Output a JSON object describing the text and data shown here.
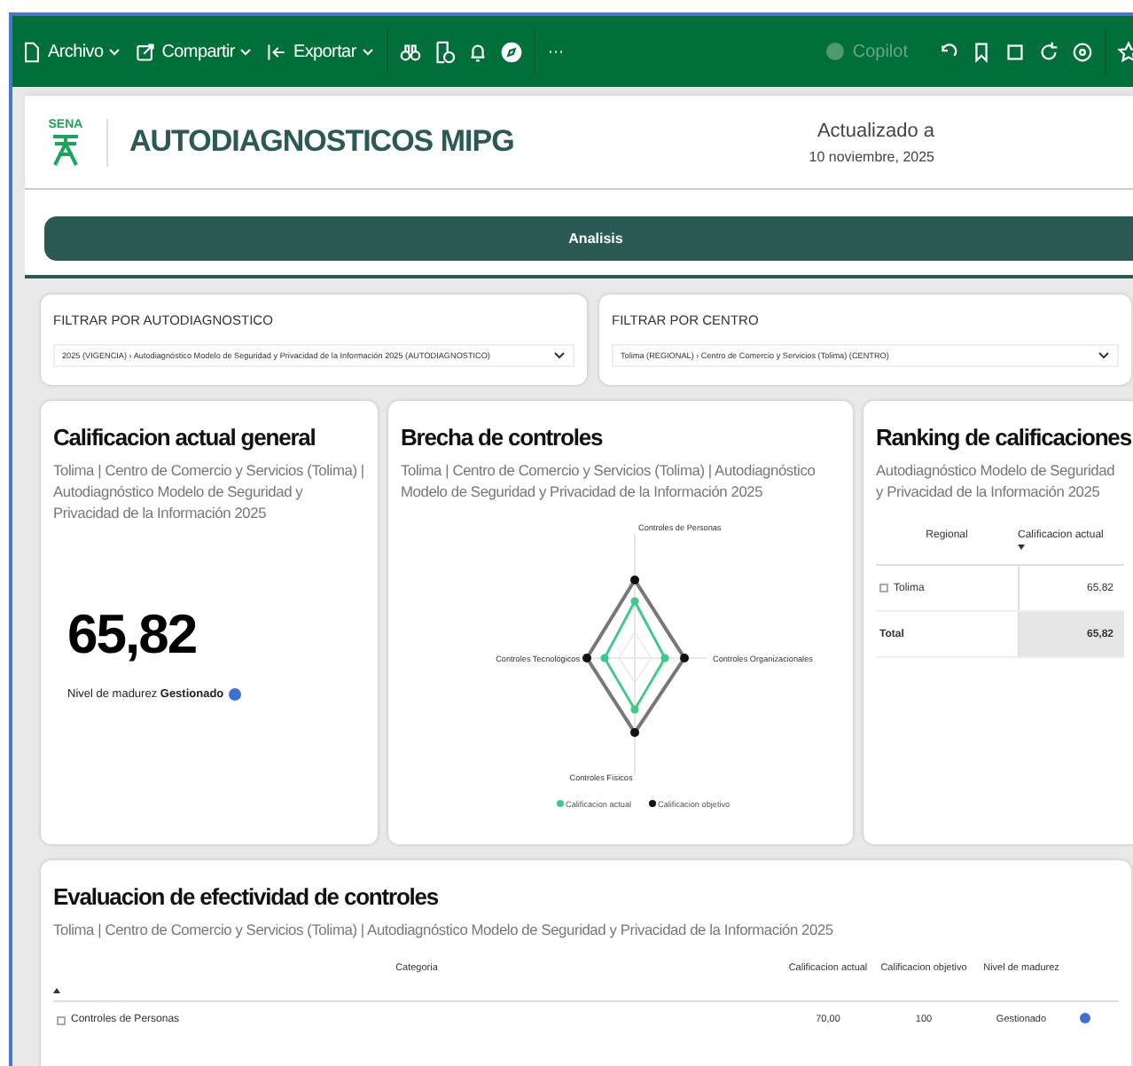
{
  "toolbar": {
    "menus": [
      {
        "label": "Archivo"
      },
      {
        "label": "Compartir"
      },
      {
        "label": "Exportar"
      }
    ],
    "more": "···",
    "copilot": {
      "label": "Copilot",
      "disabled": true
    }
  },
  "header": {
    "logo_text": "SENA",
    "title": "AUTODIAGNOSTICOS MIPG",
    "updated_label": "Actualizado a",
    "updated_date": "10 noviembre, 2025"
  },
  "nav_button": "Analisis",
  "filters": [
    {
      "label": "FILTRAR POR AUTODIAGNOSTICO",
      "value": "2025 (VIGENCIA) › Autodiagnóstico Modelo de Seguridad y Privacidad de la Información 2025 (AUTODIAGNOSTICO)"
    },
    {
      "label": "FILTRAR POR CENTRO",
      "value": "Tolima (REGIONAL) › Centro de Comercio y Servicios (Tolima) (CENTRO)"
    }
  ],
  "score_card": {
    "title": "Calificacion actual general",
    "subtitle": "Tolima | Centro de Comercio y Servicios (Tolima) | Autodiagnóstico Modelo de Seguridad y Privacidad de la Información 2025",
    "value": "65,82",
    "maturity": {
      "text": "Nivel de madurez **Gestionado**",
      "color": "#3d6fd4"
    }
  },
  "gap_card": {
    "title": "Brecha de controles",
    "subtitle": "Tolima | Centro de Comercio y Servicios (Tolima) | Autodiagnóstico Modelo de Seguridad y Privacidad de la Información 2025",
    "axes": [
      "Controles de Personas",
      "Controles Organizacionales",
      "Controles Físicos",
      "Controles Tecnológicos"
    ],
    "legend": [
      {
        "label": "Calificacion actual",
        "color": "#3cc98a"
      },
      {
        "label": "Calificacion objetivo",
        "color": "#111111"
      }
    ]
  },
  "ranking": {
    "title": "Ranking de calificaciones",
    "subtitle": "Autodiagnóstico Modelo de Seguridad y Privacidad de la Información 2025",
    "columns": [
      "Regional",
      "Calificacion actual"
    ],
    "rows": [
      {
        "regional": "Tolima",
        "value": "65,82"
      }
    ],
    "total": {
      "label": "Total",
      "value": "65,82"
    }
  },
  "evaluation": {
    "title": "Evaluacion de efectividad de controles",
    "subtitle": "Tolima | Centro de Comercio y Servicios (Tolima) | Autodiagnóstico Modelo de Seguridad y Privacidad de la Información 2025",
    "columns": [
      "Categoria",
      "Calificacion actual",
      "Calificacion objetivo",
      "Nivel de madurez"
    ],
    "rows": [
      {
        "category": "Controles de Personas",
        "actual": "70,00",
        "target": "100",
        "level": "Gestionado",
        "color": "#3d6fd4"
      }
    ]
  }
}
